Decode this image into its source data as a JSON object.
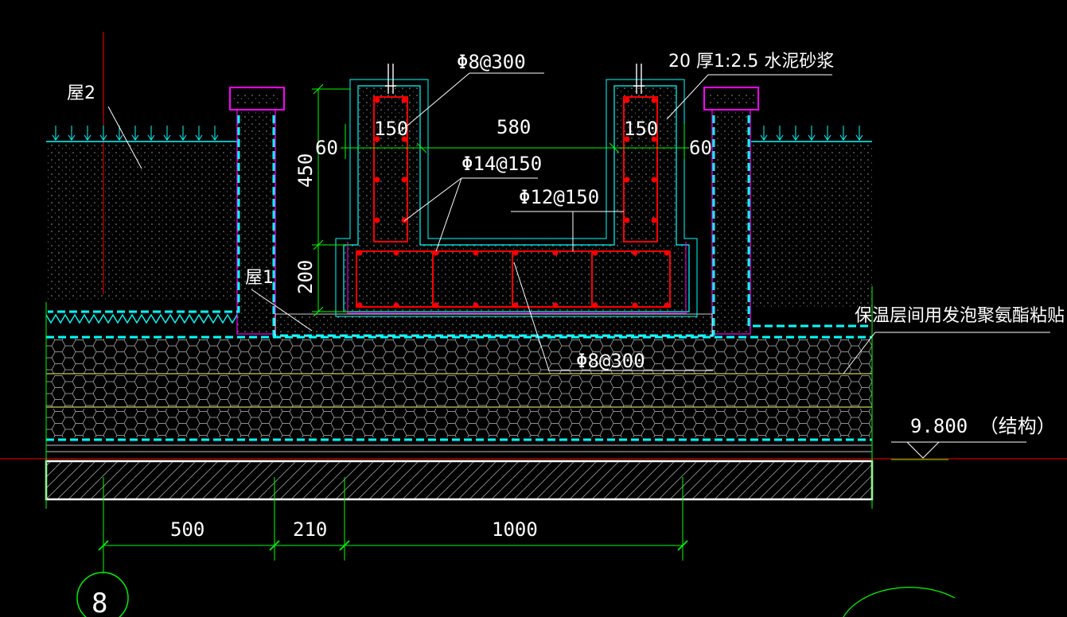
{
  "labels": {
    "roof2": "屋2",
    "roof1": "屋1",
    "rebar_phi8_300_top": "Φ8@300",
    "mortar_note": "20 厚1:2.5  水泥砂浆",
    "dim_150_left": "150",
    "dim_150_right": "150",
    "dim_580": "580",
    "dim_60_left": "60",
    "dim_60_right": "60",
    "dim_450": "450",
    "dim_200": "200",
    "rebar_phi14_150": "Φ14@150",
    "rebar_phi12_150": "Φ12@150",
    "rebar_phi8_300_bottom": "Φ8@300",
    "insulation_note": "保温层间用发泡聚氨酯粘贴",
    "elevation": "9.800 （结构）",
    "dim_500": "500",
    "dim_210": "210",
    "dim_1000": "1000",
    "axis_8": "8"
  },
  "colors": {
    "background": "#000000",
    "dimension": "#00ff00",
    "outline": "#ff00ff",
    "waterproof": "#00ffff",
    "rebar": "#ff0000",
    "text": "#ffffff",
    "insulation": "#ffff66",
    "axis": "#ff0000"
  }
}
